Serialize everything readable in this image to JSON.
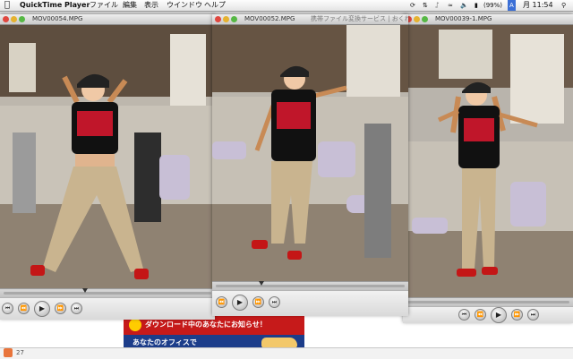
{
  "menubar": {
    "app_name": "QuickTime Player",
    "menus": [
      "ファイル",
      "編集",
      "表示",
      "ウインドウ",
      "ヘルプ"
    ],
    "battery": "(99%)",
    "input_badge": "A",
    "clock": "月 11:54"
  },
  "windows": [
    {
      "title": "MOV00054.MPG",
      "progress": 0.4
    },
    {
      "title": "MOV00052.MPG",
      "title_behind": "携帯ファイル変換サービス | おくれ",
      "progress": 0.25
    },
    {
      "title": "MOV00039-1.MPG",
      "progress": 0.0
    }
  ],
  "webpage": {
    "banner_download": "ダウンロード中のあなたにお知らせ！",
    "banner_office": "あなたのオフィスで",
    "footer_text": "27"
  },
  "colors": {
    "shirt": "#111111",
    "shirt_print": "#c0162a",
    "pants": "#c9b48f",
    "shoes": "#c41616",
    "floor": "#8f8272",
    "machine_pad": "#c8bfd6"
  },
  "icons": [
    "apple-icon",
    "play-icon",
    "rewind-icon",
    "fast-forward-icon",
    "skip-back-icon",
    "skip-forward-icon"
  ]
}
